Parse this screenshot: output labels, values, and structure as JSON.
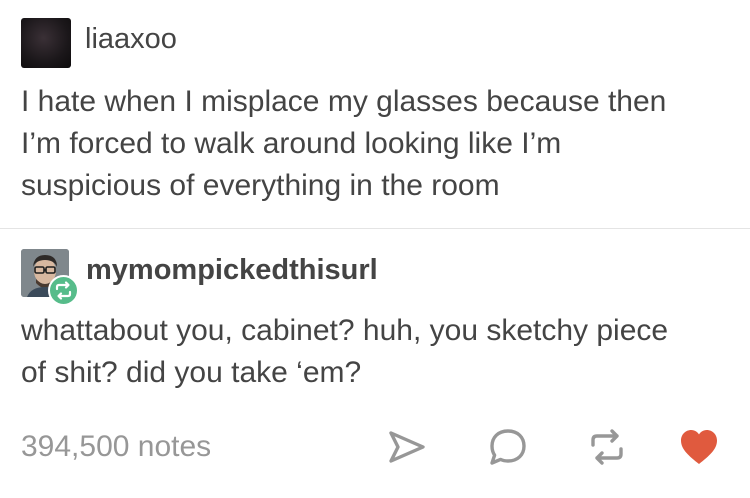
{
  "original_post": {
    "username": "liaaxoo",
    "lines": [
      "I hate when I misplace my glasses because then",
      "I’m forced to walk around looking like I’m",
      "suspicious of everything in the room"
    ]
  },
  "reblog": {
    "username": "mymompickedthisurl",
    "lines": [
      "whattabout you, cabinet? huh, you sketchy piece",
      "of shit? did you take ‘em?"
    ]
  },
  "footer": {
    "notes": "394,500 notes",
    "actions": [
      "share-icon",
      "reply-icon",
      "reblog-icon",
      "like-icon"
    ],
    "like_color": "#e05a3e",
    "icon_color": "#979797"
  },
  "colors": {
    "text": "#444444",
    "reblog_badge": "#56bc8a"
  }
}
